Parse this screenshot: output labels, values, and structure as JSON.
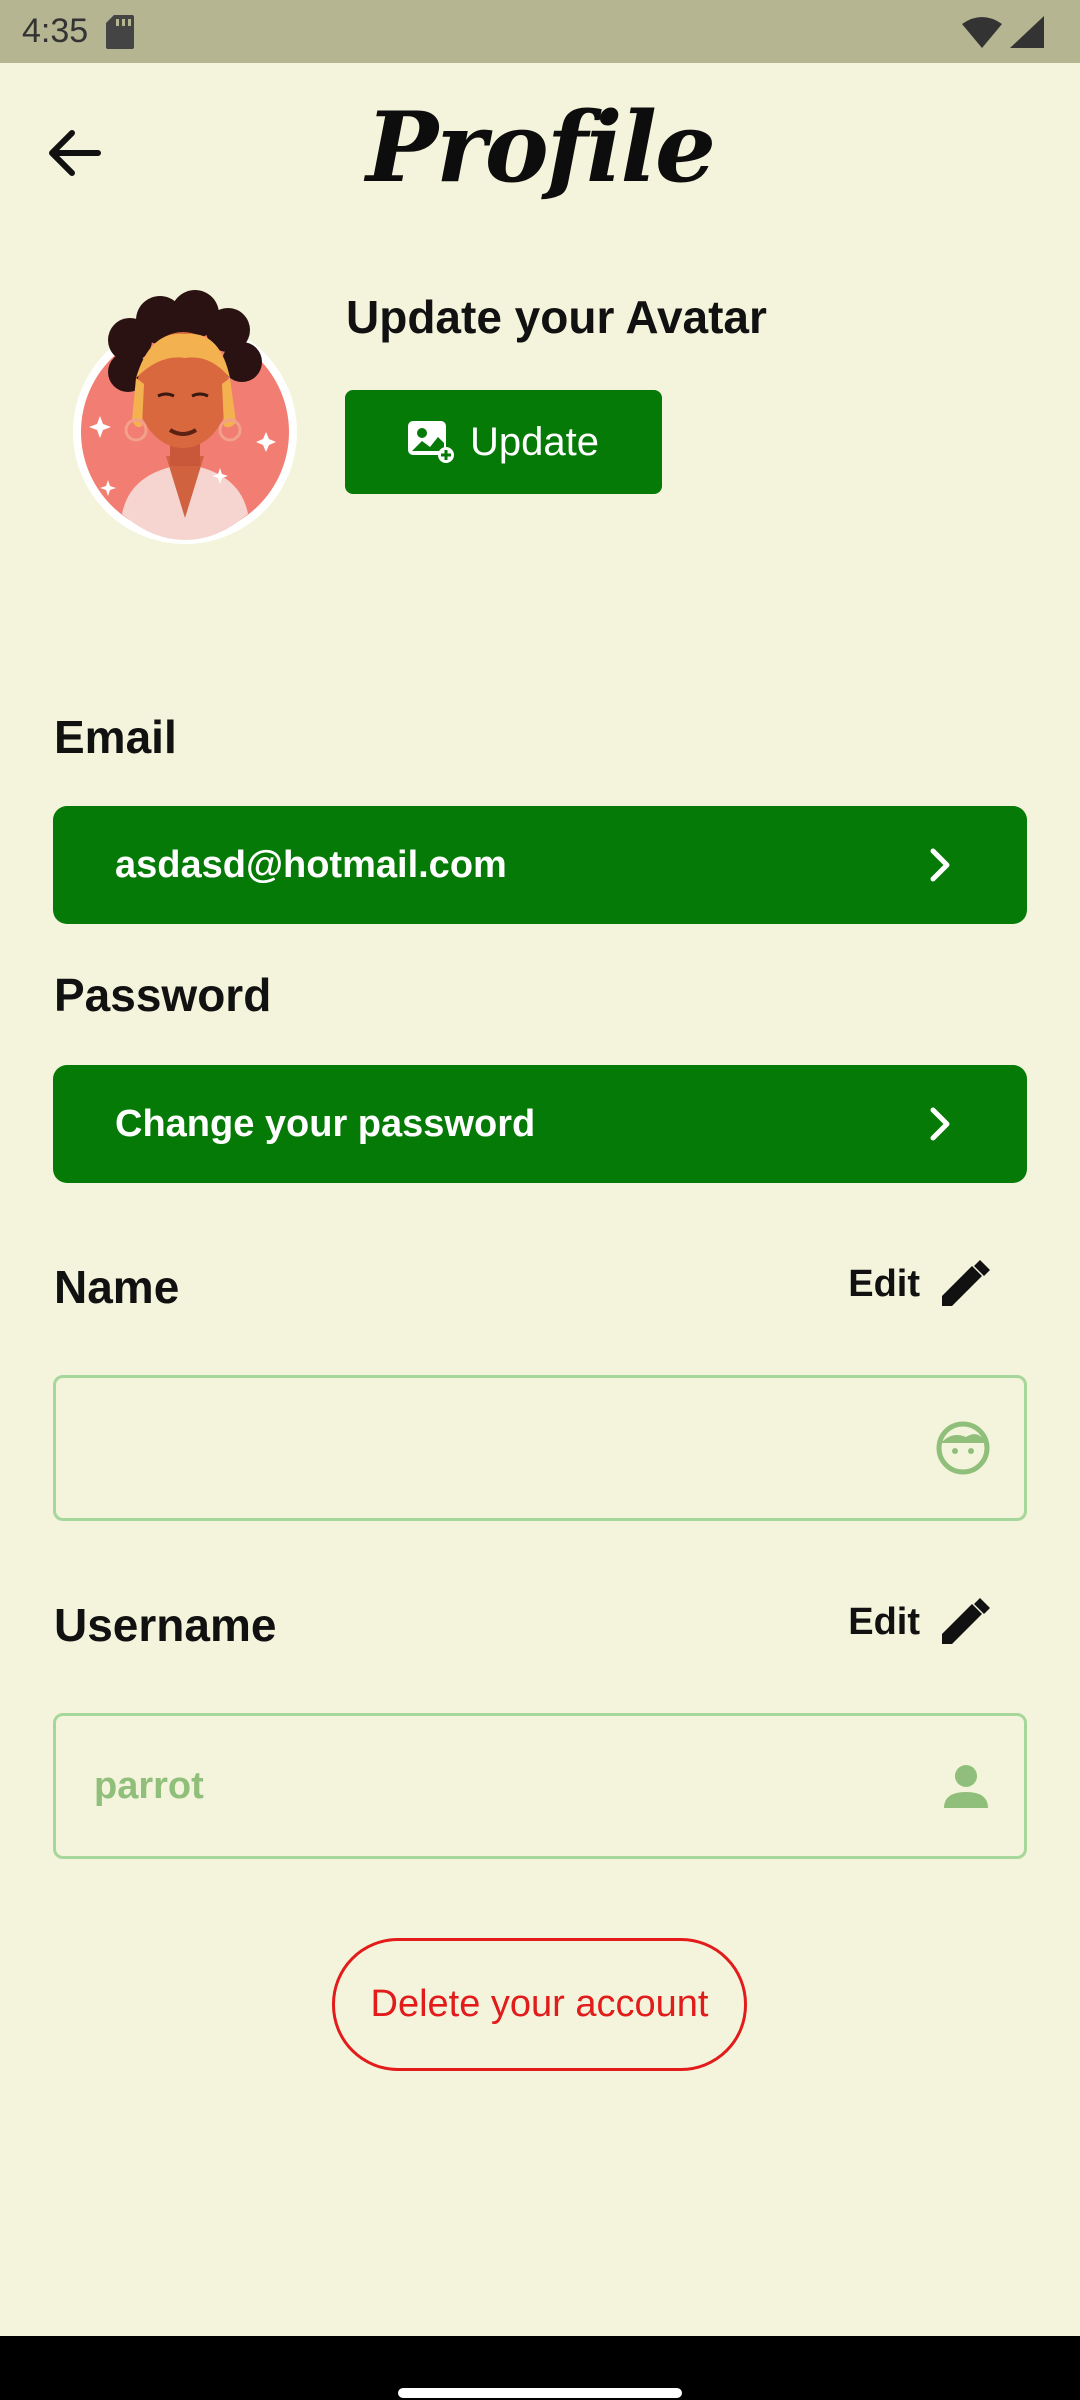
{
  "status": {
    "time": "4:35"
  },
  "header": {
    "title": "Profile"
  },
  "avatar": {
    "title": "Update your Avatar",
    "update_label": "Update"
  },
  "email": {
    "label": "Email",
    "value": "asdasd@hotmail.com"
  },
  "password": {
    "label": "Password",
    "action": "Change your password"
  },
  "name": {
    "label": "Name",
    "edit_label": "Edit",
    "value": ""
  },
  "username": {
    "label": "Username",
    "edit_label": "Edit",
    "value": "parrot"
  },
  "delete_label": "Delete your account",
  "colors": {
    "background": "#f4f4dc",
    "primary_green": "#067a06",
    "field_border": "#a7d69a",
    "danger": "#e21b1b"
  },
  "icons": [
    "sdcard-icon",
    "wifi-icon",
    "signal-icon",
    "back-arrow-icon",
    "add-photo-icon",
    "chevron-right-icon",
    "edit-pencil-icon",
    "face-icon",
    "person-icon"
  ]
}
